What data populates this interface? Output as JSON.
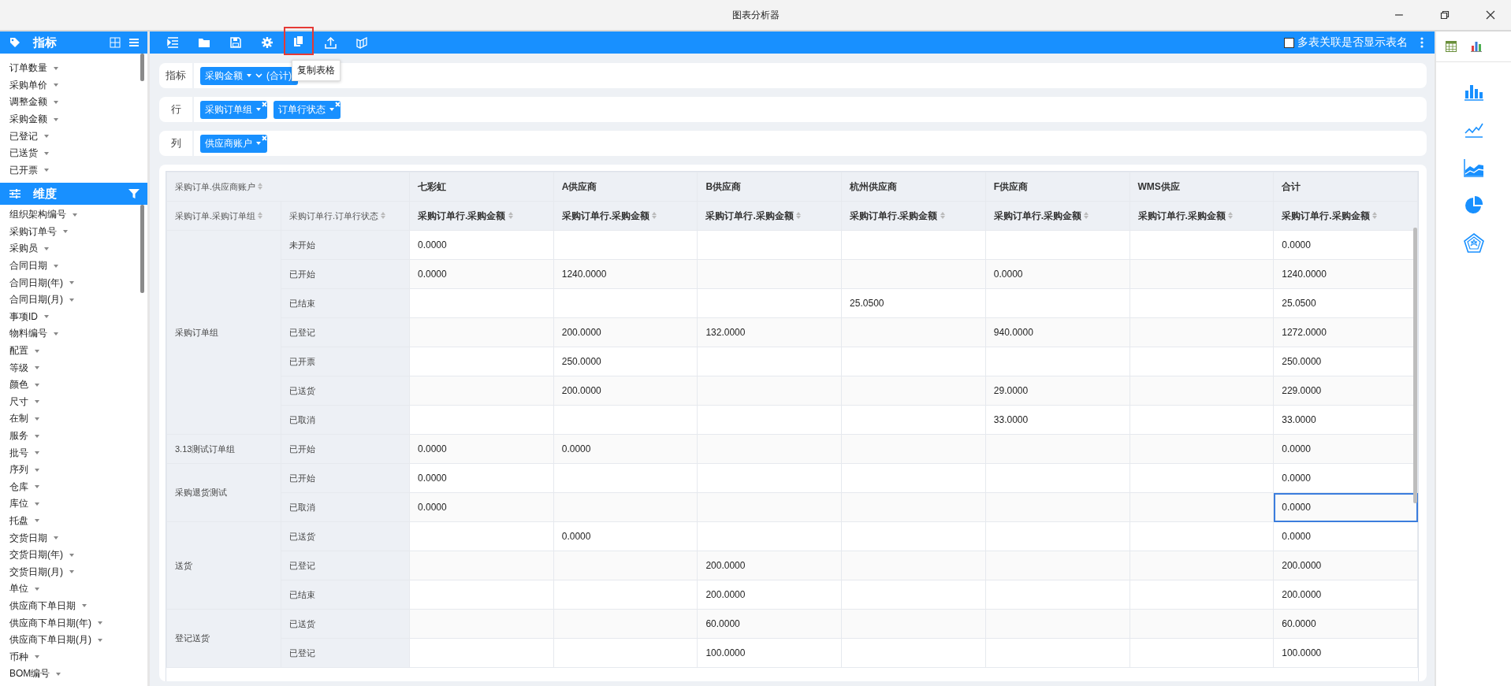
{
  "window": {
    "title": "图表分析器"
  },
  "sidebar": {
    "metrics": {
      "title": "指标",
      "items": [
        "订单数量",
        "采购单价",
        "调整金额",
        "采购金额",
        "已登记",
        "已送货",
        "已开票"
      ]
    },
    "dimensions": {
      "title": "维度",
      "items": [
        "组织架构编号",
        "采购订单号",
        "采购员",
        "合同日期",
        "合同日期(年)",
        "合同日期(月)",
        "事项ID",
        "物料编号",
        "配置",
        "等级",
        "颜色",
        "尺寸",
        "在制",
        "服务",
        "批号",
        "序列",
        "仓库",
        "库位",
        "托盘",
        "交货日期",
        "交货日期(年)",
        "交货日期(月)",
        "单位",
        "供应商下单日期",
        "供应商下单日期(年)",
        "供应商下单日期(月)",
        "币种",
        "BOM编号"
      ]
    }
  },
  "toolbar": {
    "buttons": [
      {
        "kind": "indent",
        "highlighted": false
      },
      {
        "kind": "folder",
        "highlighted": false
      },
      {
        "kind": "save",
        "highlighted": false
      },
      {
        "kind": "settings",
        "highlighted": false
      },
      {
        "kind": "copy",
        "highlighted": true
      },
      {
        "kind": "upload",
        "highlighted": false
      },
      {
        "kind": "layers",
        "highlighted": false
      }
    ],
    "tooltip": "复制表格",
    "option": {
      "label": "多表关联是否显示表名",
      "checked": false
    }
  },
  "filters": [
    {
      "label": "指标",
      "chips": [
        {
          "text": "采购金额",
          "suffix": "(合计)",
          "removable": false
        }
      ]
    },
    {
      "label": "行",
      "chips": [
        {
          "text": "采购订单组",
          "removable": true
        },
        {
          "text": "订单行状态",
          "removable": true
        }
      ]
    },
    {
      "label": "列",
      "chips": [
        {
          "text": "供应商账户",
          "removable": true
        }
      ]
    }
  ],
  "table": {
    "corner_top": "采购订单.供应商账户",
    "corner_group": "采购订单.采购订单组",
    "corner_status": "采购订单行.订单行状态",
    "columns": [
      {
        "name": "七彩虹",
        "measure": "采购订单行.采购金额"
      },
      {
        "name": "A供应商",
        "measure": "采购订单行.采购金额"
      },
      {
        "name": "B供应商",
        "measure": "采购订单行.采购金额"
      },
      {
        "name": "杭州供应商",
        "measure": "采购订单行.采购金额"
      },
      {
        "name": "F供应商",
        "measure": "采购订单行.采购金额"
      },
      {
        "name": "WMS供应",
        "measure": "采购订单行.采购金额"
      },
      {
        "name": "合计",
        "measure": "采购订单行.采购金额"
      }
    ],
    "groups": [
      {
        "name": "采购订单组",
        "rows": [
          {
            "status": "未开始",
            "values": {
              "0": "0.0000"
            },
            "total": "0.0000",
            "total_selected": false
          },
          {
            "status": "已开始",
            "values": {
              "0": "0.0000",
              "1": "1240.0000",
              "4": "0.0000"
            },
            "total": "1240.0000",
            "total_selected": false
          },
          {
            "status": "已结束",
            "values": {
              "3": "25.0500"
            },
            "total": "25.0500",
            "total_selected": false
          },
          {
            "status": "已登记",
            "values": {
              "1": "200.0000",
              "2": "132.0000",
              "4": "940.0000"
            },
            "total": "1272.0000",
            "total_selected": false
          },
          {
            "status": "已开票",
            "values": {
              "1": "250.0000"
            },
            "total": "250.0000",
            "total_selected": false
          },
          {
            "status": "已送货",
            "values": {
              "1": "200.0000",
              "4": "29.0000"
            },
            "total": "229.0000",
            "total_selected": false
          },
          {
            "status": "已取消",
            "values": {
              "4": "33.0000"
            },
            "total": "33.0000",
            "total_selected": false
          }
        ]
      },
      {
        "name": "3.13测试订单组",
        "rows": [
          {
            "status": "已开始",
            "values": {
              "0": "0.0000",
              "1": "0.0000"
            },
            "total": "0.0000",
            "total_selected": false
          }
        ]
      },
      {
        "name": "采购退货测试",
        "rows": [
          {
            "status": "已开始",
            "values": {
              "0": "0.0000"
            },
            "total": "0.0000",
            "total_selected": false
          },
          {
            "status": "已取消",
            "values": {
              "0": "0.0000"
            },
            "total": "0.0000",
            "total_selected": true
          }
        ]
      },
      {
        "name": "送货",
        "rows": [
          {
            "status": "已送货",
            "values": {
              "1": "0.0000"
            },
            "total": "0.0000",
            "total_selected": false
          },
          {
            "status": "已登记",
            "values": {
              "2": "200.0000"
            },
            "total": "200.0000",
            "total_selected": false
          },
          {
            "status": "已结束",
            "values": {
              "2": "200.0000"
            },
            "total": "200.0000",
            "total_selected": false
          }
        ]
      },
      {
        "name": "登记送货",
        "rows": [
          {
            "status": "已送货",
            "values": {
              "2": "60.0000"
            },
            "total": "60.0000",
            "total_selected": false
          },
          {
            "status": "已登记",
            "values": {
              "2": "100.0000"
            },
            "total": "100.0000",
            "total_selected": false
          }
        ]
      }
    ]
  },
  "right_panel": {
    "views": [
      {
        "kind": "table"
      },
      {
        "kind": "chart"
      }
    ],
    "chart_types": [
      {
        "kind": "bar"
      },
      {
        "kind": "line"
      },
      {
        "kind": "area"
      },
      {
        "kind": "pie"
      },
      {
        "kind": "radar"
      }
    ]
  }
}
